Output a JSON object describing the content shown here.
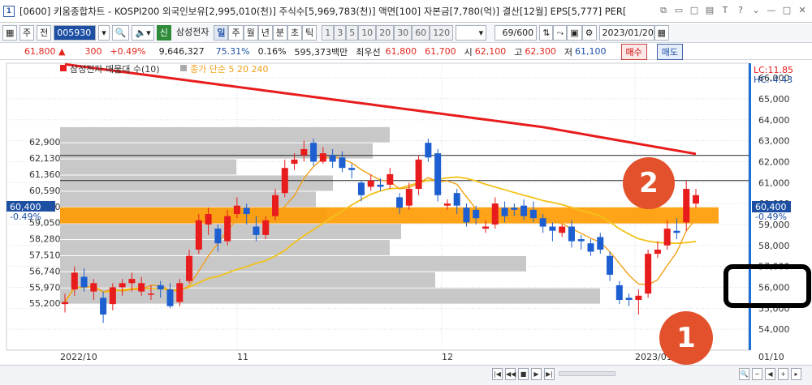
{
  "window": {
    "app_badge": "1",
    "title": "[0600] 키움종합차트 - KOSPI200 외국인보유[2,995,010(천)] 주식수[5,969,783(천)] 액면[100] 자본금[7,780(억)] 결산[12월] EPS[5,777] PER["
  },
  "toolbar": {
    "mode1": "주",
    "mode2": "전",
    "code": "005930",
    "stock_name": "삼성전자",
    "period_tabs": [
      "일",
      "주",
      "월",
      "년",
      "분",
      "초",
      "틱"
    ],
    "interval_tabs": [
      "1",
      "3",
      "5",
      "10",
      "20",
      "30",
      "60",
      "120"
    ],
    "count": "69/600",
    "date": "2023/01/20"
  },
  "quote": {
    "price": "61,800",
    "change": "300",
    "change_pct": "+0.49%",
    "volume": "9,646,327",
    "vol_ratio": "75.31%",
    "turnover_pct": "0.16%",
    "amount": "595,373백만",
    "best_label": "최우선",
    "best_ask": "61,800",
    "best_bid": "61,700",
    "open_label": "시",
    "open": "62,100",
    "high_label": "고",
    "high": "62,300",
    "low_label": "저",
    "low": "61,100",
    "buy_label": "매수",
    "sell_label": "매도"
  },
  "chart": {
    "legend_main": "삼성전자 매물대 수(10)",
    "legend_ma": "종가 단순 5  20  240",
    "lc_label": "LC:11.85",
    "hc_label": "HC:-4.43",
    "current_price_label": "60,400",
    "current_pct_label": "-0.49%",
    "left_pct_label": "-0.49%",
    "x_labels": [
      "2022/10",
      "11",
      "12",
      "2023/01",
      "01/10"
    ],
    "annotation_1": "1",
    "annotation_2": "2"
  },
  "chart_data": {
    "type": "candlestick",
    "y_axis_labels": [
      66000,
      65000,
      64000,
      63000,
      62000,
      61000,
      60000,
      59000,
      58000,
      57000,
      56000,
      55000,
      54000
    ],
    "y_range": [
      53000,
      66700
    ],
    "volume_profile_levels": [
      "62,900",
      "62,130",
      "61,360",
      "60,590",
      "59,820",
      "59,050",
      "58,280",
      "57,510",
      "56,740",
      "55,970",
      "55,200"
    ],
    "ma_colors": {
      "ma5": "#f2a019",
      "ma20": "#f2c219",
      "ma240": "#e81c1c"
    },
    "highlight_band": [
      59050,
      59820
    ],
    "h_lines": [
      62300,
      61100
    ],
    "candles": [
      {
        "o": 55200,
        "c": 55300,
        "h": 55700,
        "l": 54800
      },
      {
        "o": 55900,
        "c": 56700,
        "h": 57000,
        "l": 55600
      },
      {
        "o": 56500,
        "c": 56000,
        "h": 56900,
        "l": 55800
      },
      {
        "o": 55800,
        "c": 56200,
        "h": 56400,
        "l": 55400
      },
      {
        "o": 55500,
        "c": 54700,
        "h": 55800,
        "l": 54300
      },
      {
        "o": 55200,
        "c": 56000,
        "h": 56200,
        "l": 54900
      },
      {
        "o": 56000,
        "c": 56200,
        "h": 56400,
        "l": 55600
      },
      {
        "o": 56200,
        "c": 56400,
        "h": 56700,
        "l": 55800
      },
      {
        "o": 55800,
        "c": 56200,
        "h": 56500,
        "l": 55600
      },
      {
        "o": 55700,
        "c": 55700,
        "h": 56100,
        "l": 55400
      },
      {
        "o": 56100,
        "c": 55900,
        "h": 56300,
        "l": 55500
      },
      {
        "o": 55900,
        "c": 55100,
        "h": 56200,
        "l": 55000
      },
      {
        "o": 55300,
        "c": 56200,
        "h": 56400,
        "l": 55100
      },
      {
        "o": 56300,
        "c": 57500,
        "h": 57800,
        "l": 56200
      },
      {
        "o": 57800,
        "c": 59200,
        "h": 59500,
        "l": 57600
      },
      {
        "o": 59000,
        "c": 59500,
        "h": 59800,
        "l": 58500
      },
      {
        "o": 58800,
        "c": 58100,
        "h": 59000,
        "l": 57700
      },
      {
        "o": 58200,
        "c": 59400,
        "h": 59700,
        "l": 58000
      },
      {
        "o": 59500,
        "c": 59900,
        "h": 60300,
        "l": 59300
      },
      {
        "o": 59800,
        "c": 59500,
        "h": 60000,
        "l": 59000
      },
      {
        "o": 58900,
        "c": 58500,
        "h": 59400,
        "l": 58200
      },
      {
        "o": 58500,
        "c": 59200,
        "h": 59400,
        "l": 58300
      },
      {
        "o": 59400,
        "c": 60400,
        "h": 60700,
        "l": 59200
      },
      {
        "o": 60500,
        "c": 61700,
        "h": 62100,
        "l": 60300
      },
      {
        "o": 61900,
        "c": 62100,
        "h": 62400,
        "l": 61600
      },
      {
        "o": 62300,
        "c": 62600,
        "h": 63000,
        "l": 62000
      },
      {
        "o": 62900,
        "c": 62000,
        "h": 63100,
        "l": 61800
      },
      {
        "o": 62000,
        "c": 62400,
        "h": 62700,
        "l": 61900
      },
      {
        "o": 62300,
        "c": 62000,
        "h": 62600,
        "l": 61700
      },
      {
        "o": 62200,
        "c": 61700,
        "h": 62500,
        "l": 61500
      },
      {
        "o": 61700,
        "c": 61600,
        "h": 61900,
        "l": 61200
      },
      {
        "o": 61000,
        "c": 60400,
        "h": 61100,
        "l": 60100
      },
      {
        "o": 60800,
        "c": 61100,
        "h": 61400,
        "l": 60600
      },
      {
        "o": 60900,
        "c": 60800,
        "h": 61200,
        "l": 60600
      },
      {
        "o": 60900,
        "c": 61400,
        "h": 61700,
        "l": 60700
      },
      {
        "o": 60300,
        "c": 59800,
        "h": 60500,
        "l": 59500
      },
      {
        "o": 59900,
        "c": 60700,
        "h": 61000,
        "l": 59700
      },
      {
        "o": 60700,
        "c": 62100,
        "h": 62300,
        "l": 60400
      },
      {
        "o": 62900,
        "c": 62200,
        "h": 63100,
        "l": 62000
      },
      {
        "o": 62400,
        "c": 60400,
        "h": 62600,
        "l": 60100
      },
      {
        "o": 59900,
        "c": 60000,
        "h": 60200,
        "l": 59700
      },
      {
        "o": 60500,
        "c": 59900,
        "h": 60700,
        "l": 59500
      },
      {
        "o": 59800,
        "c": 59100,
        "h": 60000,
        "l": 58900
      },
      {
        "o": 59700,
        "c": 59300,
        "h": 59900,
        "l": 59000
      },
      {
        "o": 58800,
        "c": 58900,
        "h": 59200,
        "l": 58600
      },
      {
        "o": 59000,
        "c": 60000,
        "h": 60300,
        "l": 58800
      },
      {
        "o": 59800,
        "c": 59400,
        "h": 60100,
        "l": 59100
      },
      {
        "o": 59800,
        "c": 59700,
        "h": 60000,
        "l": 59400
      },
      {
        "o": 59900,
        "c": 59400,
        "h": 60200,
        "l": 59200
      },
      {
        "o": 59700,
        "c": 59300,
        "h": 60100,
        "l": 59100
      },
      {
        "o": 59300,
        "c": 58900,
        "h": 59500,
        "l": 58600
      },
      {
        "o": 58900,
        "c": 58700,
        "h": 59100,
        "l": 58200
      },
      {
        "o": 58600,
        "c": 58900,
        "h": 59000,
        "l": 58400
      },
      {
        "o": 58900,
        "c": 58200,
        "h": 59200,
        "l": 57900
      },
      {
        "o": 58300,
        "c": 58200,
        "h": 58500,
        "l": 57800
      },
      {
        "o": 58100,
        "c": 57700,
        "h": 58300,
        "l": 57500
      },
      {
        "o": 58400,
        "c": 57800,
        "h": 58600,
        "l": 57600
      },
      {
        "o": 57500,
        "c": 56600,
        "h": 57700,
        "l": 56300
      },
      {
        "o": 56100,
        "c": 55400,
        "h": 56300,
        "l": 55200
      },
      {
        "o": 55500,
        "c": 55400,
        "h": 55700,
        "l": 55100
      },
      {
        "o": 55400,
        "c": 55600,
        "h": 55900,
        "l": 54700
      },
      {
        "o": 55700,
        "c": 57600,
        "h": 57800,
        "l": 55500
      },
      {
        "o": 57600,
        "c": 57800,
        "h": 58200,
        "l": 57400
      },
      {
        "o": 58000,
        "c": 58800,
        "h": 59200,
        "l": 57800
      },
      {
        "o": 58700,
        "c": 58600,
        "h": 59300,
        "l": 58300
      },
      {
        "o": 59100,
        "c": 60700,
        "h": 61100,
        "l": 58700
      },
      {
        "o": 60000,
        "c": 60400,
        "h": 60700,
        "l": 59800
      }
    ]
  }
}
